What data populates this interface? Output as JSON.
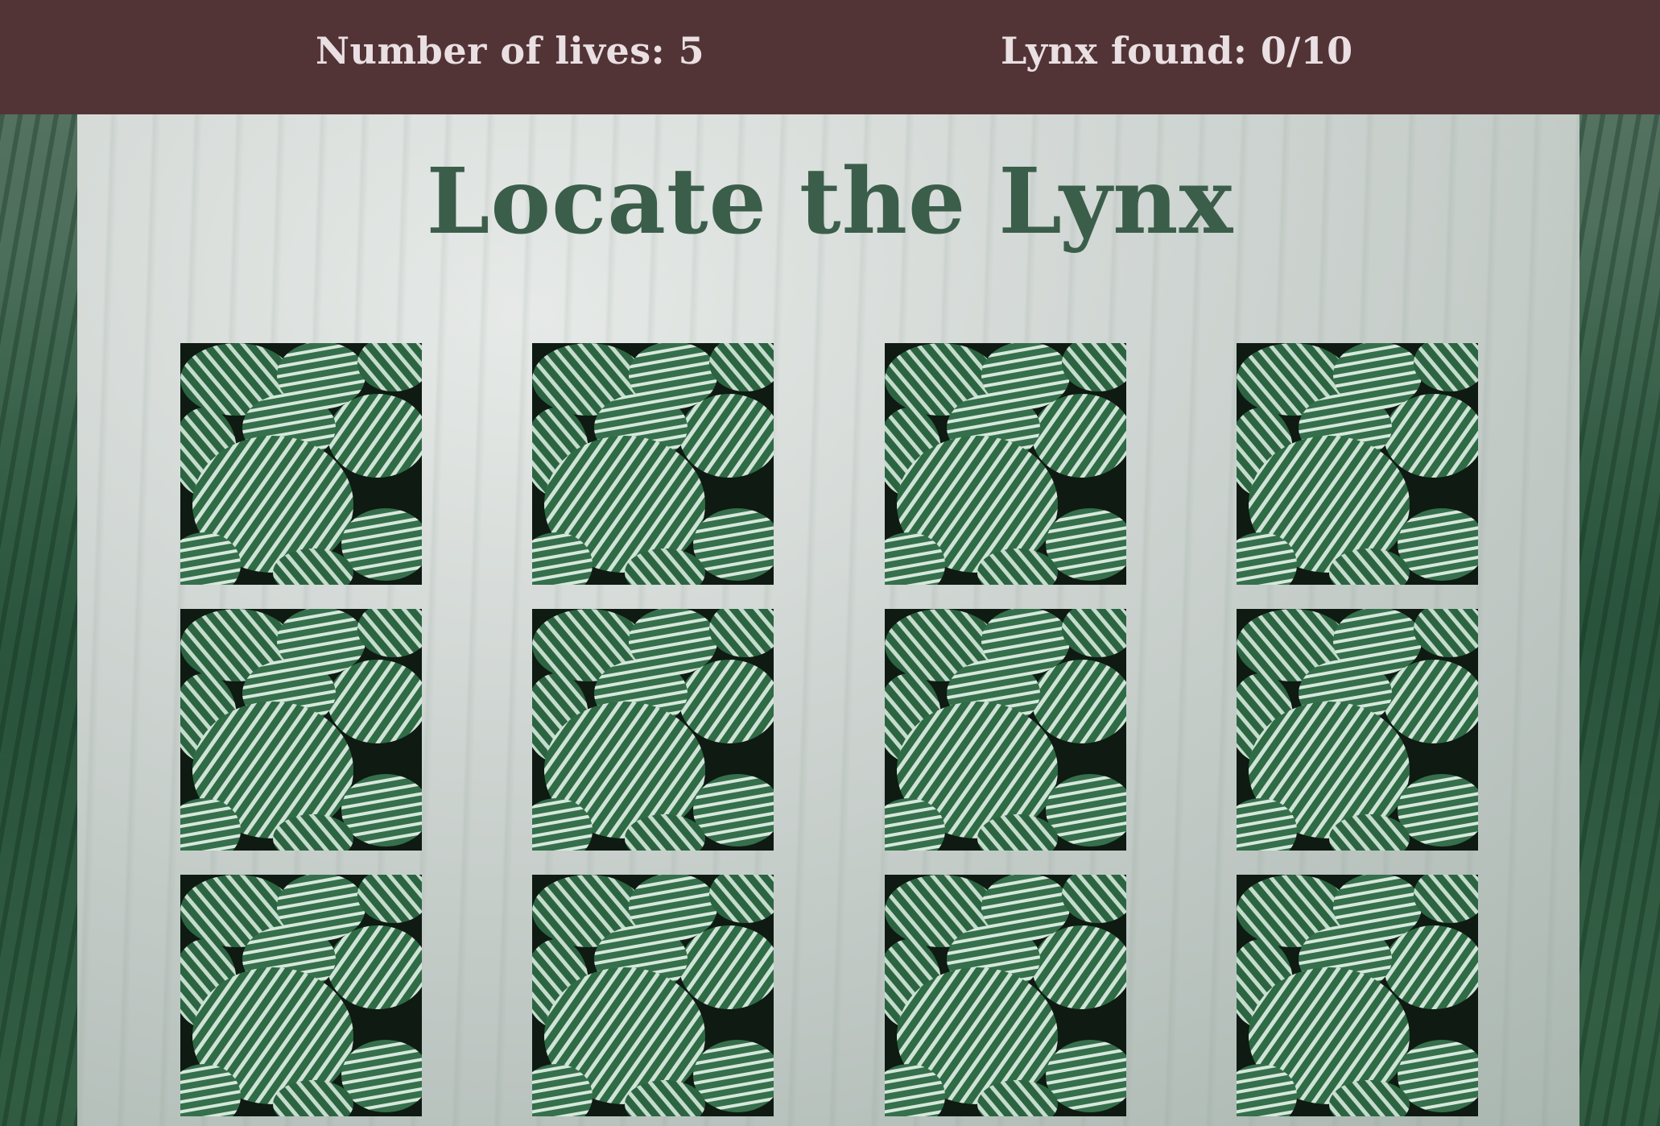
{
  "header": {
    "lives_text": "Number of lives: 5",
    "found_text": "Lynx found: 0/10"
  },
  "game": {
    "title": "Locate the Lynx",
    "lives": 5,
    "found": 0,
    "total": 10,
    "tile_icon": "striped-leaf-image",
    "tiles": [
      {
        "row": 1,
        "col": 1
      },
      {
        "row": 1,
        "col": 2
      },
      {
        "row": 1,
        "col": 3
      },
      {
        "row": 1,
        "col": 4
      },
      {
        "row": 2,
        "col": 1
      },
      {
        "row": 2,
        "col": 2
      },
      {
        "row": 2,
        "col": 3
      },
      {
        "row": 2,
        "col": 4
      },
      {
        "row": 3,
        "col": 1
      },
      {
        "row": 3,
        "col": 2
      },
      {
        "row": 3,
        "col": 3
      },
      {
        "row": 3,
        "col": 4
      }
    ]
  },
  "colors": {
    "topbar": "#523437",
    "topbar_text": "#eadfe2",
    "title": "#3b5e4b",
    "leaf_dark": "#2f6b45",
    "leaf_light": "#cfe3d6"
  }
}
